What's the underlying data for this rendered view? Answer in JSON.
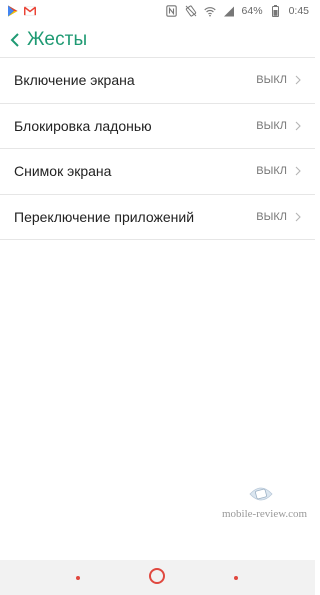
{
  "status_bar": {
    "battery": "64%",
    "time": "0:45",
    "left_icons": [
      "play-store-icon",
      "gmail-icon"
    ],
    "right_icons": [
      "nfc-icon",
      "rotation-lock-icon",
      "wifi-icon",
      "signal-icon"
    ]
  },
  "app_bar": {
    "title": "Жесты"
  },
  "settings": [
    {
      "label": "Включение экрана",
      "value": "ВЫКЛ"
    },
    {
      "label": "Блокировка ладонью",
      "value": "ВЫКЛ"
    },
    {
      "label": "Снимок экрана",
      "value": "ВЫКЛ"
    },
    {
      "label": "Переключение приложений",
      "value": "ВЫКЛ"
    }
  ],
  "watermark": {
    "text": "mobile-review.com"
  },
  "colors": {
    "accent": "#1f9a73",
    "nav_accent": "#e0483f"
  }
}
